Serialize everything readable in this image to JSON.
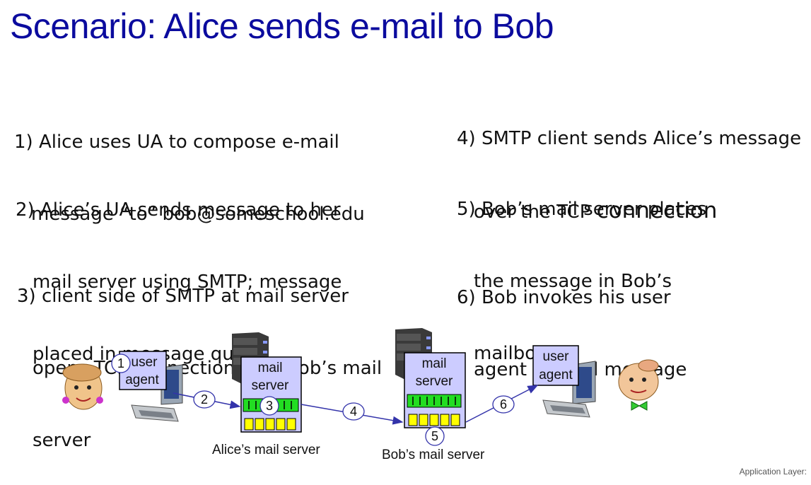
{
  "title": "Scenario: Alice sends e-mail to Bob",
  "steps": [
    {
      "lines": [
        "1) Alice uses UA to compose e-mail",
        "message “to” bob@someschool.edu"
      ]
    },
    {
      "lines": [
        "2) Alice’s UA sends message to her",
        "mail server using SMTP; message",
        "placed in message queue"
      ]
    },
    {
      "lines": [
        "3) client side of SMTP at mail server",
        "opens TCP connection with Bob’s mail",
        "server"
      ]
    },
    {
      "lines": [
        "4) SMTP client sends Alice’s message",
        "over the TCP"
      ],
      "big_word": "connection"
    },
    {
      "lines": [
        "5) Bob’s mail server places",
        "the message in Bob’s",
        "mailbox"
      ]
    },
    {
      "lines": [
        "6) Bob invokes his user",
        "agent to read message"
      ]
    }
  ],
  "diagram": {
    "alice_ua": {
      "line1": "user",
      "line2": "agent"
    },
    "alice_server": {
      "line1": "mail",
      "line2": "server",
      "caption": "Alice’s mail server"
    },
    "bob_server": {
      "line1": "mail",
      "line2": "server",
      "caption": "Bob’s mail server"
    },
    "bob_ua": {
      "line1": "user",
      "line2": "agent"
    },
    "markers": [
      "1",
      "2",
      "3",
      "4",
      "5",
      "6"
    ]
  },
  "footer": "Application Layer:",
  "colors": {
    "title": "#0b0b9e",
    "box_fill": "#ccccff",
    "queue_green": "#22dd22",
    "mailbox_yellow": "#ffff00",
    "arrow": "#3333aa"
  }
}
